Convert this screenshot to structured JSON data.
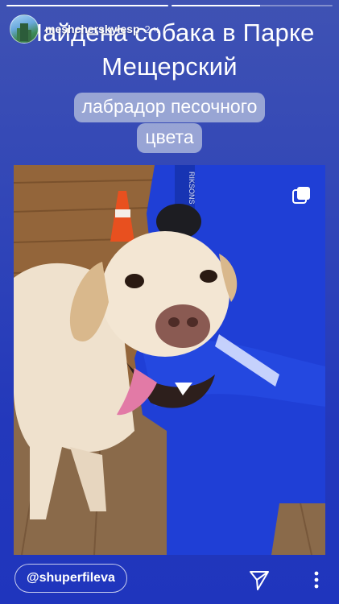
{
  "story": {
    "progress": [
      1.0,
      0.55
    ],
    "username": "meshcherskylesp",
    "time": "2 ч",
    "title": "Найдена собака в Парке Мещерский",
    "subtitle_lines": [
      "лабрадор песочного",
      "цвета"
    ],
    "mention": "@shuperfileva"
  },
  "icons": {
    "avatar": "profile-avatar",
    "gallery": "multiple-photos-icon",
    "send": "send-paper-plane-icon",
    "more": "more-vertical-dots-icon"
  },
  "colors": {
    "background": "#2f44b8",
    "accent": "#ffffff",
    "highlight": "#bec8e1"
  }
}
